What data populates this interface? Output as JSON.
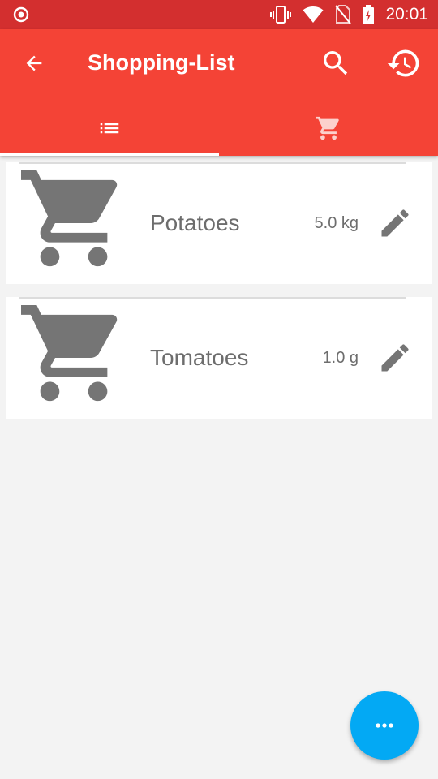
{
  "status_bar": {
    "time": "20:01",
    "icons": [
      "record-icon",
      "vibrate-icon",
      "wifi-icon",
      "no-sim-icon",
      "battery-charging-icon"
    ]
  },
  "app_bar": {
    "title": "Shopping-List",
    "icons": [
      "back-arrow-icon",
      "search-icon",
      "history-icon"
    ]
  },
  "tabs": [
    {
      "icon": "list-icon",
      "active": true
    },
    {
      "icon": "cart-icon",
      "active": false
    }
  ],
  "items": [
    {
      "name": "Potatoes",
      "quantity": "5.0 kg",
      "icon": "cart-icon"
    },
    {
      "name": "Tomatoes",
      "quantity": "1.0 g",
      "icon": "cart-icon"
    }
  ],
  "fab": {
    "icon": "more-horiz-icon"
  },
  "colors": {
    "status_bar": "#d32f2f",
    "app_bar": "#f44336",
    "fab": "#03a9f4",
    "background": "#f3f3f3",
    "text_gray": "#6d6d6d"
  }
}
